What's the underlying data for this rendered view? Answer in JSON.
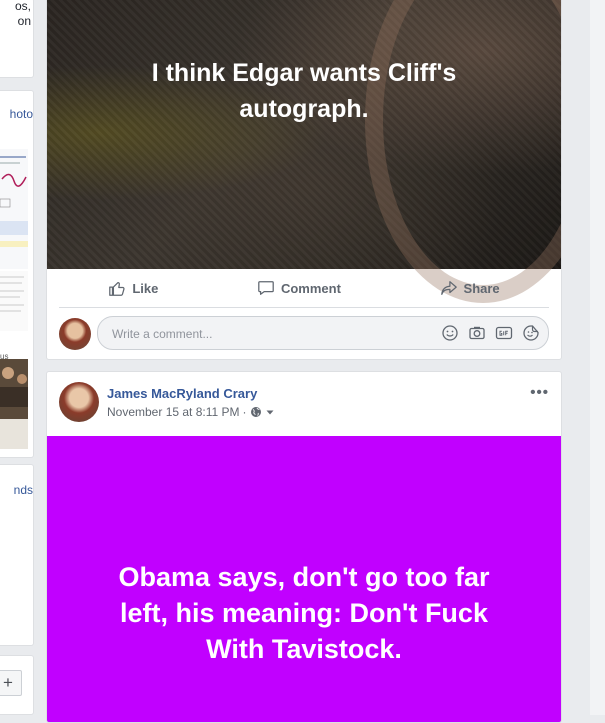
{
  "left_column": {
    "card1_lines": [
      "os,",
      "on"
    ],
    "card2_label": "hoto",
    "card2_small_label": "us",
    "card3_label": "nds",
    "card4_button": "+"
  },
  "post1": {
    "hero_text_lines": [
      "I think Edgar wants Cliff's",
      "autograph."
    ],
    "actions": {
      "like": "Like",
      "comment": "Comment",
      "share": "Share"
    },
    "comment_placeholder": "Write a comment..."
  },
  "post2": {
    "author": "James MacRyland Crary",
    "timestamp": "November 15 at 8:11 PM",
    "more_label": "•••",
    "hero_text_lines": [
      "Obama says, don't go too far",
      "left, his meaning: Don't Fuck",
      "With Tavistock."
    ],
    "hero_background": "#c100ff"
  },
  "icons": [
    "thumbs-up-icon",
    "comment-icon",
    "share-icon",
    "emoji-icon",
    "camera-icon",
    "gif-icon",
    "sticker-icon",
    "globe-icon",
    "caret-down-icon",
    "more-icon"
  ]
}
